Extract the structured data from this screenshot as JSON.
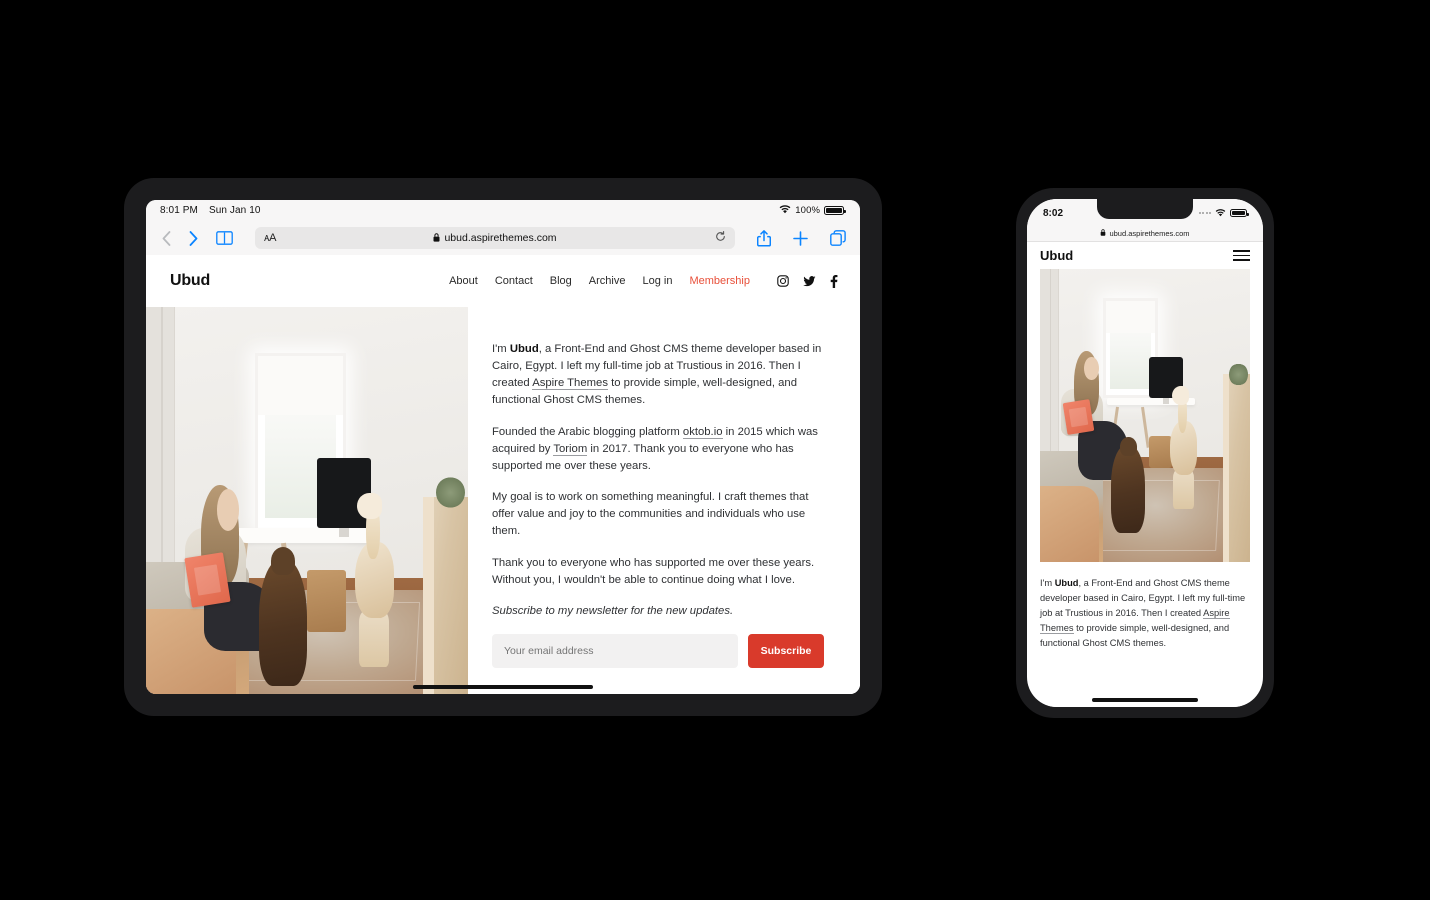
{
  "tablet": {
    "status_bar": {
      "time": "8:01 PM",
      "date": "Sun Jan 10",
      "battery": "100%",
      "wifi_icon": "wifi-icon"
    },
    "toolbar": {
      "back_icon": "back-chevron-icon",
      "forward_icon": "forward-chevron-icon",
      "sidebar_icon": "book-sidebar-icon",
      "text_size_label": "ᴀA",
      "lock_icon": "lock-icon",
      "url": "ubud.aspirethemes.com",
      "reload_icon": "reload-icon",
      "share_icon": "share-icon",
      "new_tab_icon": "plus-icon",
      "tabs_icon": "tabs-icon"
    },
    "site": {
      "brand": "Ubud",
      "nav": [
        {
          "label": "About",
          "accent": false
        },
        {
          "label": "Contact",
          "accent": false
        },
        {
          "label": "Blog",
          "accent": false
        },
        {
          "label": "Archive",
          "accent": false
        },
        {
          "label": "Log in",
          "accent": false
        },
        {
          "label": "Membership",
          "accent": true
        }
      ],
      "social": [
        {
          "name": "instagram-icon",
          "glyph": "▢"
        },
        {
          "name": "twitter-icon",
          "glyph": "ᴠ"
        },
        {
          "name": "facebook-icon",
          "glyph": "f"
        }
      ],
      "hero_photo_alt": "woman sitting on bed holding a book with two dogs in a bright bedroom",
      "paragraphs": {
        "p1_a": "I'm ",
        "p1_bold": "Ubud",
        "p1_b": ", a Front-End and Ghost CMS theme developer based in Cairo, Egypt. I left my full-time job at Trustious in 2016. Then I created ",
        "p1_link": "Aspire Themes",
        "p1_c": " to provide simple, well-designed, and functional Ghost CMS themes.",
        "p2_a": "Founded the Arabic blogging platform ",
        "p2_link1": "oktob.io",
        "p2_b": " in 2015 which was acquired by ",
        "p2_link2": "Toriom",
        "p2_c": " in 2017. Thank you to everyone who has supported me over these years.",
        "p3": "My goal is to work on something meaningful. I craft themes that offer value and joy to the communities and individuals who use them.",
        "p4": "Thank you to everyone who has supported me over these years. Without you, I wouldn't be able to continue doing what I love.",
        "p5_italic": "Subscribe to my newsletter for the new updates."
      },
      "subscribe": {
        "email_placeholder": "Your email address",
        "button_label": "Subscribe",
        "button_color": "#d93a2b"
      }
    }
  },
  "phone": {
    "status_bar": {
      "time": "8:02",
      "signal_icon": "signal-dots-icon",
      "wifi_icon": "wifi-icon",
      "battery_icon": "battery-icon"
    },
    "url_row": {
      "lock_icon": "lock-icon",
      "url": "ubud.aspirethemes.com"
    },
    "site": {
      "brand": "Ubud",
      "menu_icon": "hamburger-menu-icon",
      "hero_photo_alt": "woman sitting on bed holding a book with two dogs in a bright bedroom",
      "paragraphs": {
        "p1_a": "I'm ",
        "p1_bold": "Ubud",
        "p1_b": ", a Front-End and Ghost CMS theme developer based in Cairo, Egypt. I left my full-time job at Trustious in 2016. Then I created ",
        "p1_link": "Aspire Themes",
        "p1_c": " to provide simple, well-designed, and functional Ghost CMS themes."
      }
    }
  },
  "theme": {
    "accent": "#e8503a",
    "button": "#d93a2b",
    "ios_blue": "#0b84ff",
    "frame": "#1c1c1e",
    "page_bg": "#000000"
  }
}
